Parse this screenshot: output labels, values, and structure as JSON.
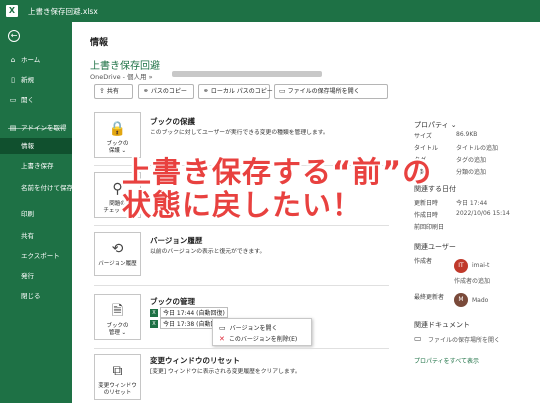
{
  "window": {
    "app_letter": "X",
    "title": "上書き保存回避.xlsx"
  },
  "sidebar": {
    "items": [
      {
        "icon": "home-icon",
        "glyph": "⌂",
        "label": "ホーム"
      },
      {
        "icon": "new-file-icon",
        "glyph": "▯",
        "label": "新規"
      },
      {
        "icon": "open-folder-icon",
        "glyph": "▭",
        "label": "開く"
      },
      {
        "icon": "",
        "glyph": "▤",
        "label": "アドインを取得"
      },
      {
        "icon": "",
        "glyph": "",
        "label": "情報"
      },
      {
        "icon": "",
        "glyph": "",
        "label": "上書き保存"
      },
      {
        "icon": "",
        "glyph": "",
        "label": "名前を付けて保存"
      },
      {
        "icon": "",
        "glyph": "",
        "label": "印刷"
      },
      {
        "icon": "",
        "glyph": "",
        "label": "共有"
      },
      {
        "icon": "",
        "glyph": "",
        "label": "エクスポート"
      },
      {
        "icon": "",
        "glyph": "",
        "label": "発行"
      },
      {
        "icon": "",
        "glyph": "",
        "label": "閉じる"
      }
    ]
  },
  "main": {
    "page_title": "情報",
    "doc_name": "上書き保存回避",
    "doc_path": "OneDrive - 個人用 »",
    "toolbar": [
      {
        "icon": "share-icon",
        "glyph": "⇪",
        "label": "共有"
      },
      {
        "icon": "link-icon",
        "glyph": "⚭",
        "label": "パスのコピー"
      },
      {
        "icon": "link-icon",
        "glyph": "⚭",
        "label": "ローカル パスのコピー"
      },
      {
        "icon": "folder-icon",
        "glyph": "▭",
        "label": "ファイルの保存場所を開く"
      }
    ],
    "protect": {
      "card_label_1": "ブックの",
      "card_label_2": "保護 ⌄",
      "title": "ブックの保護",
      "desc": "このブックに対してユーザーが実行できる変更の種類を管理します。"
    },
    "inspect": {
      "card_label_1": "問題の",
      "card_label_2": "チェック ⌄"
    },
    "history": {
      "card_label": "バージョン履歴",
      "title": "バージョン履歴",
      "desc": "以前のバージョンの表示と復元ができます。"
    },
    "manage": {
      "card_label_1": "ブックの",
      "card_label_2": "管理 ⌄",
      "title": "ブックの管理",
      "versions": [
        "今日 17:44 (自動回復)",
        "今日 17:38 (自動回復)"
      ]
    },
    "context_menu": [
      "バージョンを開く",
      "このバージョンを削除(E)"
    ],
    "reset": {
      "card_label_1": "変更ウィンドウ",
      "card_label_2": "のリセット",
      "title": "変更ウィンドウのリセット",
      "desc": "[変更] ウィンドウに表示される変更履歴をクリアします。"
    }
  },
  "properties": {
    "head": "プロパティ ⌄",
    "rows": [
      {
        "key": "サイズ",
        "value": "86.9KB"
      },
      {
        "key": "タイトル",
        "value": "タイトルの追加"
      },
      {
        "key": "タグ",
        "value": "タグの追加"
      },
      {
        "key": "分類",
        "value": "分類の追加"
      }
    ],
    "dates_head": "関連する日付",
    "dates": [
      {
        "key": "更新日時",
        "value": "今日 17:44"
      },
      {
        "key": "作成日時",
        "value": "2022/10/06 15:14"
      },
      {
        "key": "前回印刷日",
        "value": ""
      }
    ],
    "users_head": "関連ユーザー",
    "author_key": "作成者",
    "author": {
      "initials": "IT",
      "name": "imai-t",
      "color": "#c0392b"
    },
    "add_author": "作成者の追加",
    "modifier_key": "最終更新者",
    "modifier": {
      "initials": "M",
      "name": "Mado",
      "color": "#7a4a3a"
    },
    "docs_head": "関連ドキュメント",
    "open_location": "ファイルの保存場所を開く",
    "show_all": "プロパティをすべて表示"
  },
  "overlay": {
    "line1": "上書き保存する“前”の",
    "line2": "状態に戻したい！",
    "color": "#e8413f"
  }
}
